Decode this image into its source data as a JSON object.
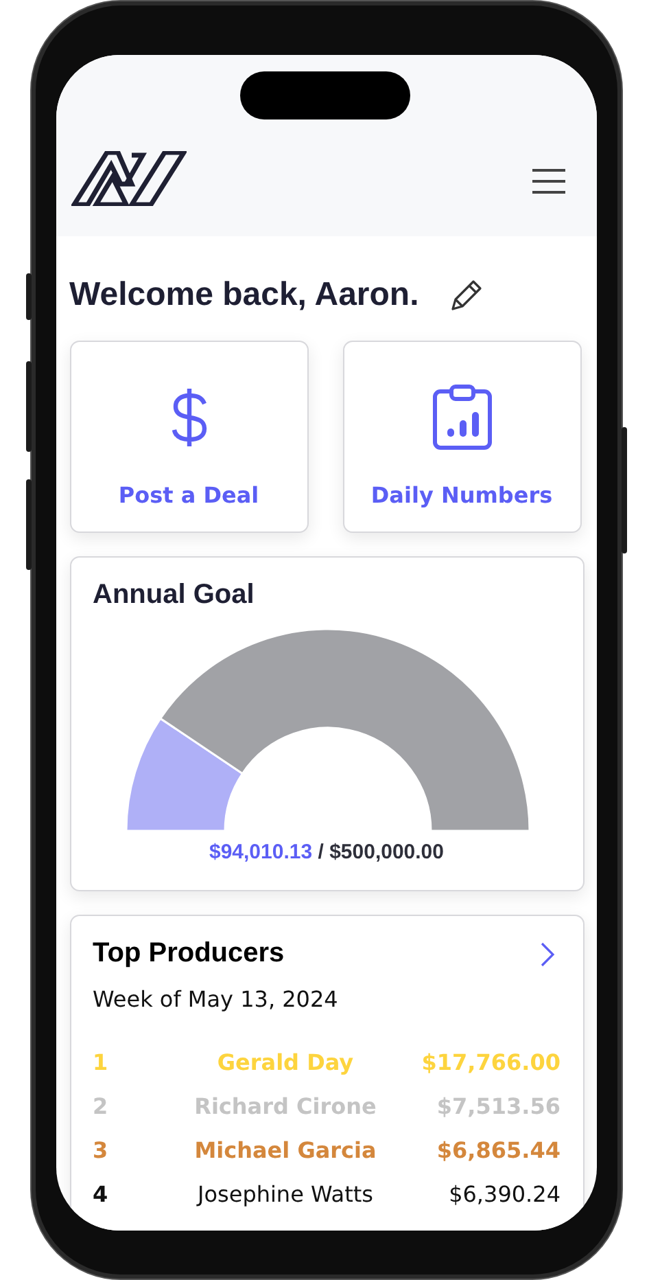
{
  "greeting": "Welcome back, Aaron.",
  "actions": [
    {
      "kind": "dollar",
      "label": "Post a Deal"
    },
    {
      "kind": "clipboard-chart",
      "label": "Daily Numbers"
    }
  ],
  "annual_goal": {
    "title": "Annual Goal",
    "level": 0.188,
    "current": "$94,010.13",
    "separator": "/",
    "target": "$500,000.00"
  },
  "top_producers": {
    "title": "Top Producers",
    "subtitle": "Week of May 13, 2024",
    "rows": [
      {
        "rank": "1",
        "name": "Gerald Day",
        "amount": "$17,766.00",
        "kind": "medal",
        "color": "#fdd43e"
      },
      {
        "rank": "2",
        "name": "Richard Cirone",
        "amount": "$7,513.56",
        "kind": "medal",
        "color": "#c4c4c4"
      },
      {
        "rank": "3",
        "name": "Michael Garcia",
        "amount": "$6,865.44",
        "kind": "medal",
        "color": "#d4873c"
      },
      {
        "rank": "4",
        "name": "Josephine Watts",
        "amount": "$6,390.24",
        "kind": "plain",
        "color": "#111111"
      }
    ]
  }
}
